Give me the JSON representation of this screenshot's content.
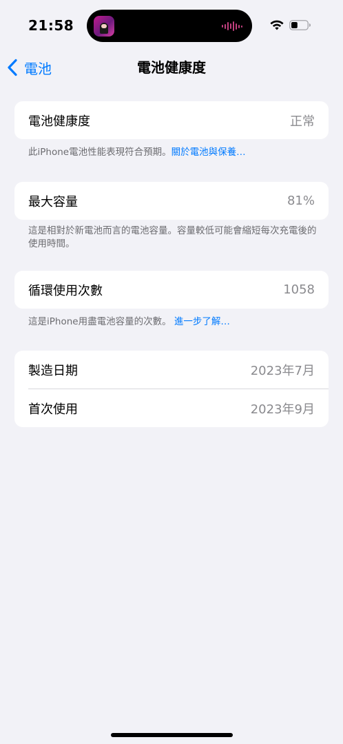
{
  "status_bar": {
    "time": "21:58",
    "icons": [
      "wifi-icon",
      "battery-icon",
      "audio-waveform-icon"
    ]
  },
  "nav": {
    "back_label": "電池",
    "title": "電池健康度"
  },
  "health": {
    "label": "電池健康度",
    "value": "正常",
    "footer_text": "此iPhone電池性能表現符合預期。",
    "footer_link": "關於電池與保養…"
  },
  "capacity": {
    "label": "最大容量",
    "value": "81%",
    "footer_text": "這是相對於新電池而言的電池容量。容量較低可能會縮短每次充電後的使用時間。"
  },
  "cycles": {
    "label": "循環使用次數",
    "value": "1058",
    "footer_text": "這是iPhone用盡電池容量的次數。",
    "footer_link": "進一步了解…"
  },
  "dates": {
    "manufacture_label": "製造日期",
    "manufacture_value": "2023年7月",
    "first_use_label": "首次使用",
    "first_use_value": "2023年9月"
  },
  "colors": {
    "background": "#f2f2f7",
    "accent": "#007aff",
    "secondary_text": "#8a8a8e",
    "battery_level": 0.4
  }
}
